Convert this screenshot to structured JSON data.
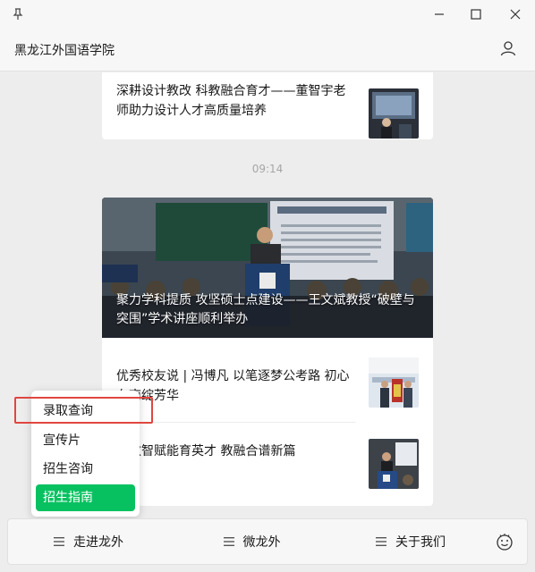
{
  "window": {
    "app_title": "黑龙江外国语学院"
  },
  "feed": {
    "card1": {
      "title": "深耕设计教改 科教融合育才——董智宇老师助力设计人才高质量培养"
    },
    "timestamp": "09:14",
    "card2": {
      "hero_title": "聚力学科提质 攻坚硕士点建设——王文斌教授“破壁与突围”学术讲座顺利举办",
      "items": [
        {
          "title": "优秀校友说 | 冯博凡 以笔逐梦公考路 初心在南绽芳华"
        },
        {
          "title": "：数智赋能育英才 教融合谱新篇"
        }
      ]
    }
  },
  "popup_menu": {
    "items": [
      {
        "label": "录取查询",
        "active": false
      },
      {
        "label": "宣传片",
        "active": false
      },
      {
        "label": "招生咨询",
        "active": false
      },
      {
        "label": "招生指南",
        "active": true
      }
    ],
    "highlight_color": "#e0463f",
    "active_color": "#07c160"
  },
  "bottom_menu": {
    "items": [
      {
        "label": "走进龙外",
        "icon": "menu-icon"
      },
      {
        "label": "微龙外",
        "icon": "menu-icon"
      },
      {
        "label": "关于我们",
        "icon": "menu-icon"
      }
    ],
    "emoji_icon": "emoji-icon"
  },
  "icons": {
    "pin": "pin-icon",
    "minimize": "minimize-icon",
    "maximize": "maximize-icon",
    "close": "close-icon",
    "user": "user-icon"
  }
}
